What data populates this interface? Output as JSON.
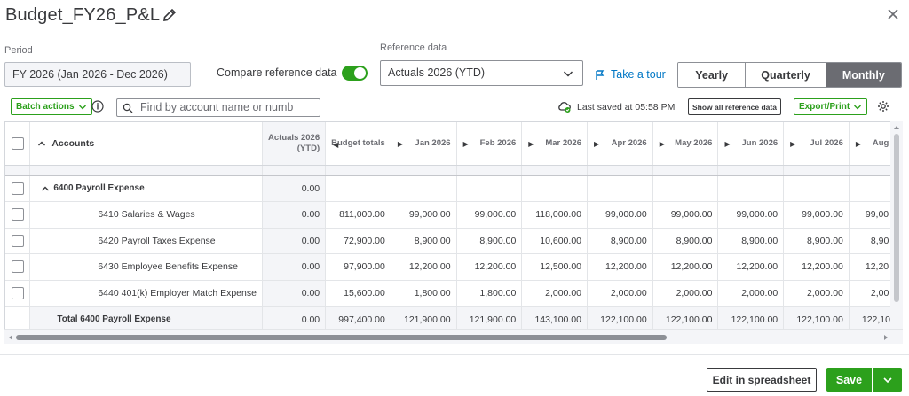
{
  "header": {
    "title": "Budget_FY26_P&L",
    "edit_icon": "pencil-icon",
    "close_icon": "close-icon"
  },
  "filters": {
    "period_label": "Period",
    "period_value": "FY 2026 (Jan 2026 - Dec 2026)",
    "compare_label": "Compare reference data",
    "compare_on": true,
    "reference_label": "Reference data",
    "reference_value": "Actuals 2026 (YTD)",
    "tour_link": "Take a tour",
    "view_options": [
      "Yearly",
      "Quarterly",
      "Monthly"
    ],
    "view_selected": "Monthly"
  },
  "toolbar": {
    "batch_actions": "Batch actions",
    "search_placeholder": "Find by account name or numb",
    "last_saved": "Last saved at 05:58 PM",
    "show_reference": "Show all reference data",
    "export": "Export/Print"
  },
  "grid": {
    "columns": {
      "accounts": "Accounts",
      "ytd": "Actuals 2026 (YTD)",
      "budget": "Budget totals",
      "months": [
        "Jan 2026",
        "Feb 2026",
        "Mar 2026",
        "Apr 2026",
        "May 2026",
        "Jun 2026",
        "Jul 2026",
        "Aug"
      ]
    },
    "group": {
      "name": "6400 Payroll Expense",
      "ytd": "0.00"
    },
    "rows": [
      {
        "name": "6410 Salaries & Wages",
        "ytd": "0.00",
        "budget": "811,000.00",
        "months": [
          "99,000.00",
          "99,000.00",
          "118,000.00",
          "99,000.00",
          "99,000.00",
          "99,000.00",
          "99,000.00",
          "99,00"
        ]
      },
      {
        "name": "6420 Payroll Taxes Expense",
        "ytd": "0.00",
        "budget": "72,900.00",
        "months": [
          "8,900.00",
          "8,900.00",
          "10,600.00",
          "8,900.00",
          "8,900.00",
          "8,900.00",
          "8,900.00",
          "8,90"
        ]
      },
      {
        "name": "6430 Employee Benefits Expense",
        "ytd": "0.00",
        "budget": "97,900.00",
        "months": [
          "12,200.00",
          "12,200.00",
          "12,500.00",
          "12,200.00",
          "12,200.00",
          "12,200.00",
          "12,200.00",
          "12,20"
        ]
      },
      {
        "name": "6440 401(k) Employer Match Expense",
        "ytd": "0.00",
        "budget": "15,600.00",
        "months": [
          "1,800.00",
          "1,800.00",
          "2,000.00",
          "2,000.00",
          "2,000.00",
          "2,000.00",
          "2,000.00",
          "2,00"
        ]
      }
    ],
    "total": {
      "name": "Total 6400 Payroll Expense",
      "ytd": "0.00",
      "budget": "997,400.00",
      "months": [
        "121,900.00",
        "121,900.00",
        "143,100.00",
        "122,100.00",
        "122,100.00",
        "122,100.00",
        "122,100.00",
        "122,10"
      ]
    }
  },
  "footer": {
    "edit_spreadsheet": "Edit in spreadsheet",
    "save": "Save"
  },
  "colors": {
    "accent_green": "#2ca01c",
    "link_blue": "#0077c5",
    "active_segment": "#6b6c72"
  }
}
